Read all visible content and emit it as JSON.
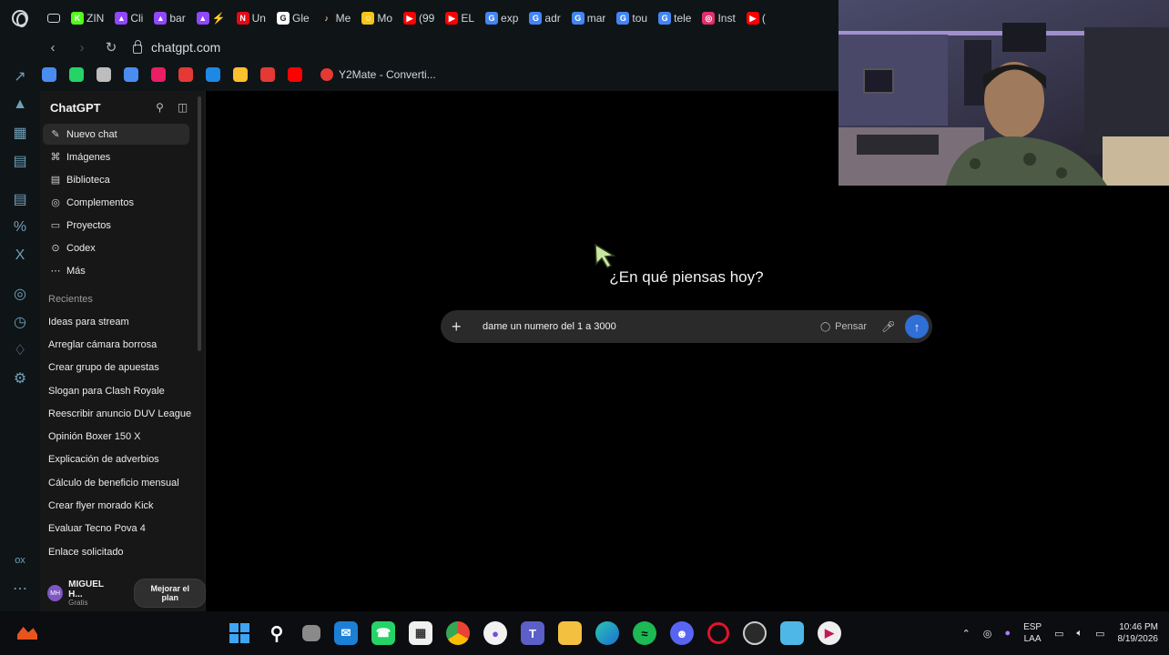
{
  "browser": {
    "tabs": [
      {
        "label": "ZIN",
        "color": "#53fc18",
        "glyph": "K"
      },
      {
        "label": "Cli",
        "color": "#9147ff",
        "glyph": "▲"
      },
      {
        "label": "bar",
        "color": "#9147ff",
        "glyph": "▲"
      },
      {
        "label": "⚡",
        "color": "#9147ff",
        "glyph": "▲"
      },
      {
        "label": "Un",
        "color": "#e50914",
        "glyph": "N"
      },
      {
        "label": "Gle",
        "color": "#ffffff",
        "glyph": "G"
      },
      {
        "label": "Me",
        "color": "#111111",
        "glyph": "♪"
      },
      {
        "label": "Mo",
        "color": "#f5c518",
        "glyph": "☺"
      },
      {
        "label": "(99",
        "color": "#ff0000",
        "glyph": "▶"
      },
      {
        "label": "EL",
        "color": "#ff0000",
        "glyph": "▶"
      },
      {
        "label": "exp",
        "color": "#4285f4",
        "glyph": "G"
      },
      {
        "label": "adr",
        "color": "#4285f4",
        "glyph": "G"
      },
      {
        "label": "mar",
        "color": "#4285f4",
        "glyph": "G"
      },
      {
        "label": "tou",
        "color": "#4285f4",
        "glyph": "G"
      },
      {
        "label": "tele",
        "color": "#4285f4",
        "glyph": "G"
      },
      {
        "label": "Inst",
        "color": "#e1306c",
        "glyph": "◎"
      },
      {
        "label": "(",
        "color": "#ff0000",
        "glyph": "▶"
      }
    ],
    "url": "chatgpt.com",
    "bookmarks": {
      "icons": [
        "#4a8df0",
        "#25d366",
        "#bdbdbd",
        "#4a8df0",
        "#e91e63",
        "#e53935",
        "#1e88e5",
        "#fbc02d",
        "#e53935",
        "#ff0000"
      ],
      "y2mate_label": "Y2Mate - Converti..."
    }
  },
  "sidebar": {
    "title": "ChatGPT",
    "nav": [
      {
        "label": "Nuevo chat",
        "icon": "✎"
      },
      {
        "label": "Imágenes",
        "icon": "⌘"
      },
      {
        "label": "Biblioteca",
        "icon": "▤"
      },
      {
        "label": "Complementos",
        "icon": "◎"
      },
      {
        "label": "Proyectos",
        "icon": "▭"
      },
      {
        "label": "Codex",
        "icon": "⊙"
      },
      {
        "label": "Más",
        "icon": "⋯"
      }
    ],
    "recents_label": "Recientes",
    "recents": [
      "Ideas para stream",
      "Arreglar cámara borrosa",
      "Crear grupo de apuestas",
      "Slogan para Clash Royale",
      "Reescribir anuncio DUV League",
      "Opinión Boxer 150 X",
      "Explicación de adverbios",
      "Cálculo de beneficio mensual",
      "Crear flyer morado Kick",
      "Evaluar Tecno Pova 4",
      "Enlace solicitado"
    ],
    "user": {
      "initials": "MH",
      "name": "MIGUEL H...",
      "plan": "Gratis"
    },
    "upgrade_label": "Mejorar el plan"
  },
  "main": {
    "greeting": "¿En qué piensas hoy?",
    "composer": {
      "value": "dame un numero del 1 a 3000",
      "think_label": "Pensar"
    }
  },
  "taskbar": {
    "lang_top": "ESP",
    "lang_bottom": "LAA",
    "time": "10:46 PM",
    "date": "8/19/2026"
  }
}
